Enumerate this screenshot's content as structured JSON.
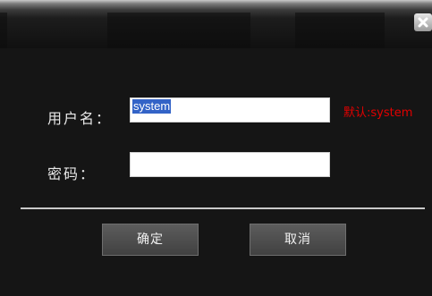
{
  "close_icon": "close-x-icon",
  "login": {
    "username_label": "用户名：",
    "username_value": "system",
    "username_hint": "默认:system",
    "password_label": "密码：",
    "password_value": ""
  },
  "buttons": {
    "ok_label": "确定",
    "cancel_label": "取消"
  },
  "colors": {
    "hint": "#e20000",
    "selection": "#3363c7",
    "background": "#151515"
  }
}
